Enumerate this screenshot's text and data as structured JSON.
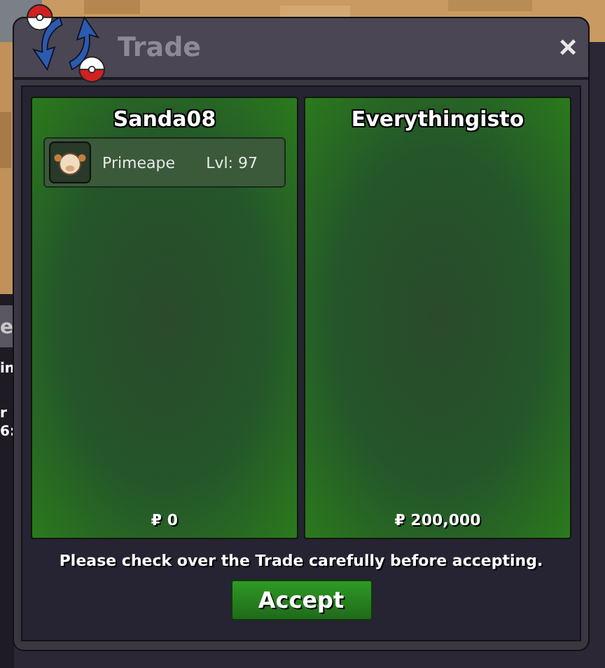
{
  "background_window": {
    "fragments": [
      "e",
      "in",
      "r",
      "6:"
    ]
  },
  "window": {
    "title": "Trade",
    "close": "×"
  },
  "offers": [
    {
      "player": "Sanda08",
      "items": [
        {
          "name": "Primeape",
          "level": "Lvl: 97"
        }
      ],
      "money": "₽ 0"
    },
    {
      "player": "Everythingisto",
      "money": "₽ 200,000"
    }
  ],
  "notice": "Please check over the Trade carefully before accepting.",
  "accept_button": "Accept"
}
